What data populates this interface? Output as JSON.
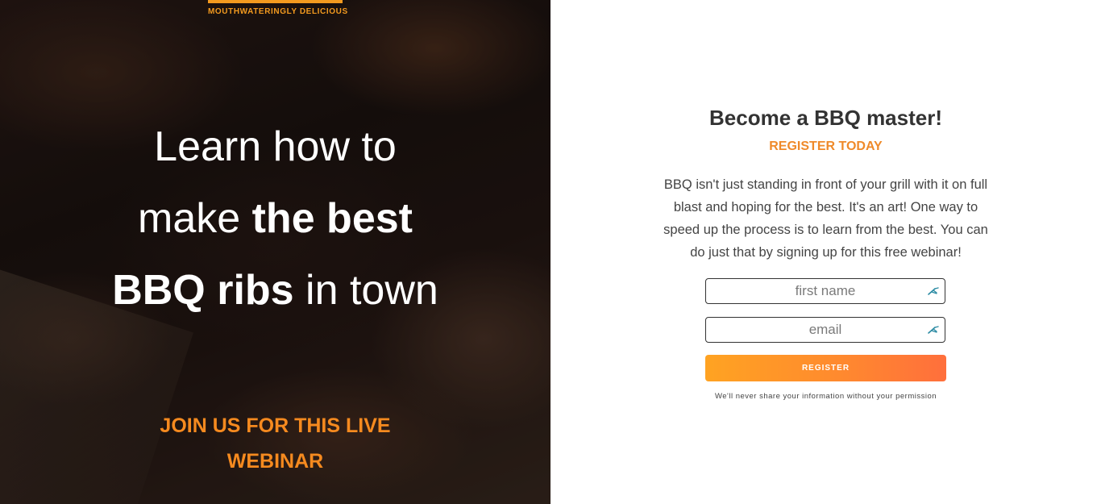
{
  "hero": {
    "tagline": "MOUTHWATERINGLY DELICIOUS",
    "headline": {
      "line1": "Learn how to",
      "line2_light": "make ",
      "line2_bold": "the best",
      "line3_bold": "BBQ ribs",
      "line3_light": " in town"
    },
    "cta_line1": "JOIN US FOR THIS LIVE",
    "cta_line2": "WEBINAR"
  },
  "form": {
    "title": "Become a BBQ master!",
    "subtitle": "REGISTER TODAY",
    "description": "BBQ isn't just standing in front of your grill with it on full blast and hoping for the best. It's an art! One way to speed up the process is to learn from the best. You can do just that by signing up for this free webinar!",
    "first_name": {
      "value": "",
      "placeholder": "first name"
    },
    "email": {
      "value": "",
      "placeholder": "email"
    },
    "register_label": "REGISTER",
    "privacy": "We'll never share your information without your permission"
  },
  "colors": {
    "accent": "#f58a1f",
    "button_start": "#ffa322",
    "button_end": "#ff6f3c",
    "title": "#333333"
  },
  "icons": {
    "field_autofill": "autofill-key-icon"
  }
}
